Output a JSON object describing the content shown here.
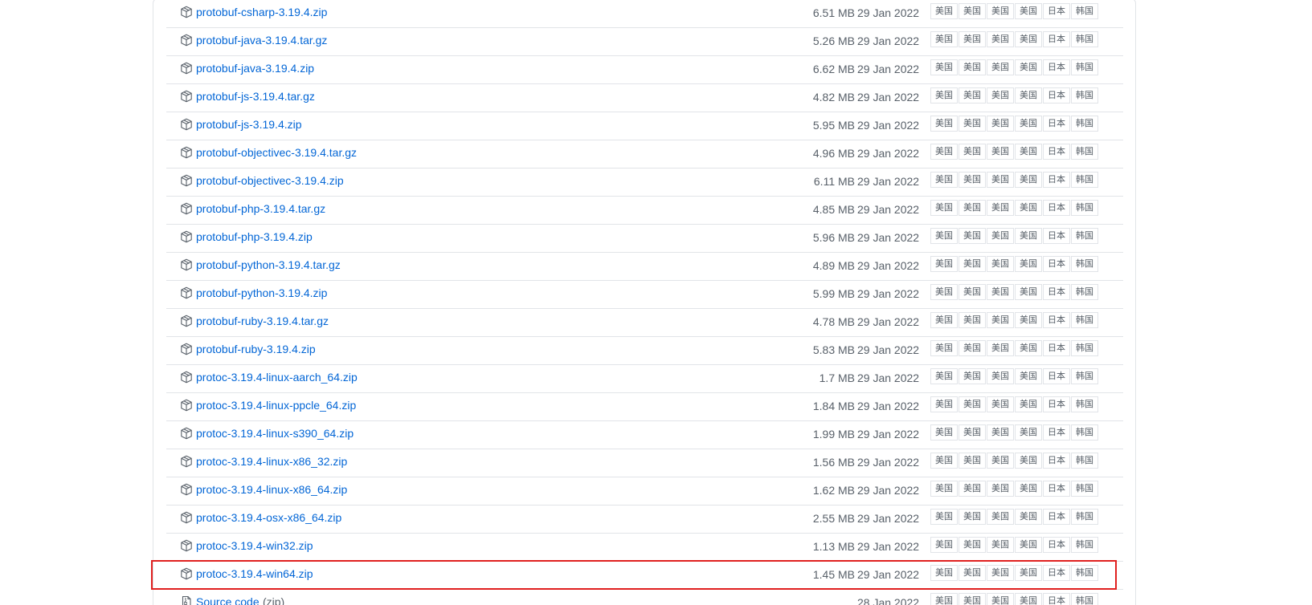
{
  "assets": [
    {
      "name": "protobuf-csharp-3.19.4.zip",
      "size": "6.51 MB",
      "date": "29 Jan 2022"
    },
    {
      "name": "protobuf-java-3.19.4.tar.gz",
      "size": "5.26 MB",
      "date": "29 Jan 2022"
    },
    {
      "name": "protobuf-java-3.19.4.zip",
      "size": "6.62 MB",
      "date": "29 Jan 2022"
    },
    {
      "name": "protobuf-js-3.19.4.tar.gz",
      "size": "4.82 MB",
      "date": "29 Jan 2022"
    },
    {
      "name": "protobuf-js-3.19.4.zip",
      "size": "5.95 MB",
      "date": "29 Jan 2022"
    },
    {
      "name": "protobuf-objectivec-3.19.4.tar.gz",
      "size": "4.96 MB",
      "date": "29 Jan 2022"
    },
    {
      "name": "protobuf-objectivec-3.19.4.zip",
      "size": "6.11 MB",
      "date": "29 Jan 2022"
    },
    {
      "name": "protobuf-php-3.19.4.tar.gz",
      "size": "4.85 MB",
      "date": "29 Jan 2022"
    },
    {
      "name": "protobuf-php-3.19.4.zip",
      "size": "5.96 MB",
      "date": "29 Jan 2022"
    },
    {
      "name": "protobuf-python-3.19.4.tar.gz",
      "size": "4.89 MB",
      "date": "29 Jan 2022"
    },
    {
      "name": "protobuf-python-3.19.4.zip",
      "size": "5.99 MB",
      "date": "29 Jan 2022"
    },
    {
      "name": "protobuf-ruby-3.19.4.tar.gz",
      "size": "4.78 MB",
      "date": "29 Jan 2022"
    },
    {
      "name": "protobuf-ruby-3.19.4.zip",
      "size": "5.83 MB",
      "date": "29 Jan 2022"
    },
    {
      "name": "protoc-3.19.4-linux-aarch_64.zip",
      "size": "1.7 MB",
      "date": "29 Jan 2022"
    },
    {
      "name": "protoc-3.19.4-linux-ppcle_64.zip",
      "size": "1.84 MB",
      "date": "29 Jan 2022"
    },
    {
      "name": "protoc-3.19.4-linux-s390_64.zip",
      "size": "1.99 MB",
      "date": "29 Jan 2022"
    },
    {
      "name": "protoc-3.19.4-linux-x86_32.zip",
      "size": "1.56 MB",
      "date": "29 Jan 2022"
    },
    {
      "name": "protoc-3.19.4-linux-x86_64.zip",
      "size": "1.62 MB",
      "date": "29 Jan 2022"
    },
    {
      "name": "protoc-3.19.4-osx-x86_64.zip",
      "size": "2.55 MB",
      "date": "29 Jan 2022"
    },
    {
      "name": "protoc-3.19.4-win32.zip",
      "size": "1.13 MB",
      "date": "29 Jan 2022"
    },
    {
      "name": "protoc-3.19.4-win64.zip",
      "size": "1.45 MB",
      "date": "29 Jan 2022"
    },
    {
      "name": "Source code",
      "suffix": "(zip)",
      "size": "",
      "date": "28 Jan 2022"
    }
  ],
  "mirror_labels": [
    "美国",
    "美国",
    "美国",
    "美国",
    "日本",
    "韩国"
  ],
  "icons": {
    "package": "package-icon",
    "source": "file-zip-icon"
  },
  "colors": {
    "link": "#0366d6",
    "muted": "#586069",
    "border": "#e1e4e8",
    "highlight": "#e0201f"
  }
}
